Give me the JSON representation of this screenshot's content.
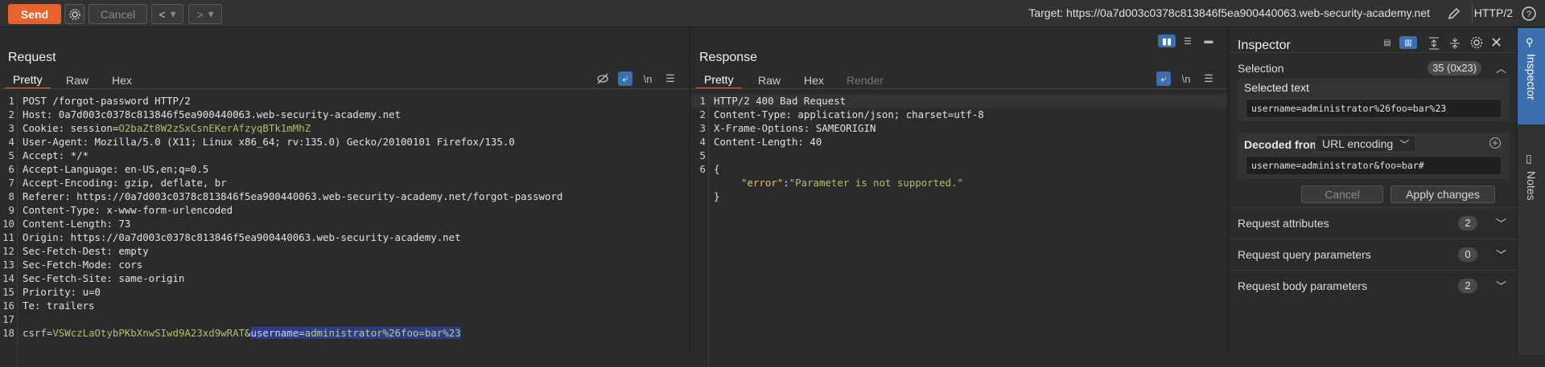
{
  "toolbar": {
    "send_label": "Send",
    "cancel_label": "Cancel",
    "target_text": "Target: https://0a7d003c0378c813846f5ea900440063.web-security-academy.net",
    "http_version": "HTTP/2"
  },
  "request": {
    "title": "Request",
    "tabs": [
      "Pretty",
      "Raw",
      "Hex"
    ],
    "newline_toggle": "\\n",
    "lines": [
      {
        "n": "1",
        "text": "POST /forgot-password HTTP/2"
      },
      {
        "n": "2",
        "text": "Host: 0a7d003c0378c813846f5ea900440063.web-security-academy.net"
      },
      {
        "n": "3",
        "key": "Cookie: session=",
        "val": "O2baZt8W2zSxCsnEKerAfzyqBTk1mMhZ"
      },
      {
        "n": "4",
        "text": "User-Agent: Mozilla/5.0 (X11; Linux x86_64; rv:135.0) Gecko/20100101 Firefox/135.0"
      },
      {
        "n": "5",
        "text": "Accept: */*"
      },
      {
        "n": "6",
        "text": "Accept-Language: en-US,en;q=0.5"
      },
      {
        "n": "7",
        "text": "Accept-Encoding: gzip, deflate, br"
      },
      {
        "n": "8",
        "text": "Referer: https://0a7d003c0378c813846f5ea900440063.web-security-academy.net/forgot-password"
      },
      {
        "n": "9",
        "text": "Content-Type: x-www-form-urlencoded"
      },
      {
        "n": "10",
        "text": "Content-Length: 73"
      },
      {
        "n": "11",
        "text": "Origin: https://0a7d003c0378c813846f5ea900440063.web-security-academy.net"
      },
      {
        "n": "12",
        "text": "Sec-Fetch-Dest: empty"
      },
      {
        "n": "13",
        "text": "Sec-Fetch-Mode: cors"
      },
      {
        "n": "14",
        "text": "Sec-Fetch-Site: same-origin"
      },
      {
        "n": "15",
        "text": "Priority: u=0"
      },
      {
        "n": "16",
        "text": "Te: trailers"
      },
      {
        "n": "17",
        "text": ""
      }
    ],
    "body_line": {
      "n": "18",
      "csrf_key": "csrf=",
      "csrf_val": "VSWczLaOtybPKbXnwSIwd9A23xd9wRAT",
      "amp": "&",
      "sel_key": "username=",
      "sel_val": "administrator%26foo=bar%23"
    }
  },
  "response": {
    "title": "Response",
    "tabs": [
      "Pretty",
      "Raw",
      "Hex",
      "Render"
    ],
    "newline_toggle": "\\n",
    "lines": [
      {
        "n": "1",
        "text": "HTTP/2 400 Bad Request"
      },
      {
        "n": "2",
        "text": "Content-Type: application/json; charset=utf-8"
      },
      {
        "n": "3",
        "text": "X-Frame-Options: SAMEORIGIN"
      },
      {
        "n": "4",
        "text": "Content-Length: 40"
      },
      {
        "n": "5",
        "text": ""
      },
      {
        "n": "6",
        "text": "{"
      }
    ],
    "json_key": "\"error\"",
    "json_colon": ":",
    "json_val": "\"Parameter is not supported.\"",
    "json_close": "}"
  },
  "inspector": {
    "title": "Inspector",
    "selection_label": "Selection",
    "selection_badge": "35 (0x23)",
    "selected_text_label": "Selected text",
    "selected_text_value": "username=administrator%26foo=bar%23",
    "decoded_from_label": "Decoded from:",
    "decoding_option": "URL encoding",
    "decoded_value": "username=administrator&foo=bar#",
    "cancel_label": "Cancel",
    "apply_label": "Apply changes",
    "sections": [
      {
        "label": "Request attributes",
        "count": "2"
      },
      {
        "label": "Request query parameters",
        "count": "0"
      },
      {
        "label": "Request body parameters",
        "count": "2"
      }
    ]
  },
  "siderail": {
    "inspector_label": "Inspector",
    "notes_label": "Notes"
  },
  "colors": {
    "accent": "#e8632b",
    "selection": "#2f3b82",
    "active_blue": "#3b6fb0"
  }
}
